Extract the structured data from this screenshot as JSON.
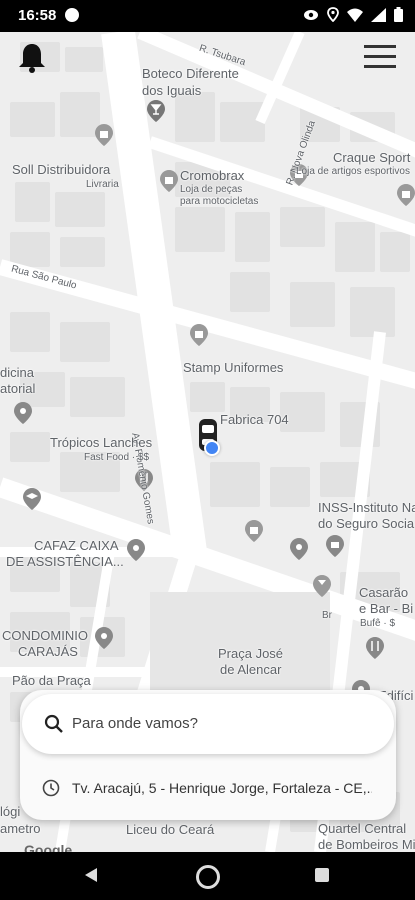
{
  "status_bar": {
    "time": "16:58"
  },
  "map": {
    "labels": {
      "boteco": "Boteco Diferente",
      "boteco2": "dos Iguais",
      "r_tsubara": "R. Tsubara",
      "soll": "Soll Distribuidora",
      "soll_sub": "Livraria",
      "cromobrax": "Cromobrax",
      "cromobrax_sub": "Loja de peças",
      "cromobrax_sub2": "para motocicletas",
      "nova_olinda": "R. Nova Olinda",
      "craque": "Craque Sport",
      "craque_sub": "Loja de artigos esportivos",
      "rua_sao_paulo": "Rua São Paulo",
      "stamp": "Stamp Uniformes",
      "medicina": "dicina",
      "medicina2": "atorial",
      "fabrica": "Fabrica 704",
      "flomenio": "Av. Flomênio Gomes",
      "tropicos": "Trópicos Lanches",
      "tropicos_sub": "Fast Food · $$",
      "inss": "INSS-Instituto Na",
      "inss2": "do Seguro Socia",
      "cafaz": "CAFAZ CAIXA",
      "cafaz2": "DE ASSISTÊNCIA...",
      "casarao": "Casarão",
      "casarao2": "e Bar - Bi",
      "casarao_sub": "Bufê · $",
      "condominio": "CONDOMINIO",
      "carajas": "CARAJÁS",
      "praca_jose": "Praça José",
      "de_alencar": "de Alencar",
      "pao": "Pão da Praça",
      "edifici": "Edifíci",
      "liceu": "Liceu do Ceará",
      "quartel": "Quartel Central",
      "bombeiros": "de Bombeiros Mi",
      "logo": "lógi",
      "metro": "ametro",
      "br": "Br"
    }
  },
  "header": {
    "bell_icon": "bell-icon",
    "menu_icon": "hamburger-menu-icon"
  },
  "search": {
    "placeholder": "Para onde vamos?"
  },
  "recent": {
    "address": "Tv. Aracajú, 5 - Henrique Jorge, Fortaleza - CE,..."
  },
  "attribution": {
    "google": "Google"
  },
  "colors": {
    "map_bg": "#eeeeee",
    "road": "#ffffff",
    "block": "#e2e2e2",
    "label": "#5f6368",
    "location_dot": "#4285f4"
  }
}
